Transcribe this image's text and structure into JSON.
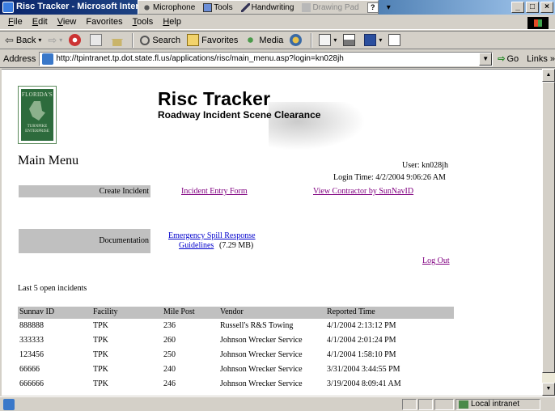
{
  "window": {
    "title": "Risc Tracker - Microsoft Inter",
    "controls": [
      "_",
      "□",
      "×"
    ]
  },
  "language_bar": {
    "microphone": "Microphone",
    "tools": "Tools",
    "handwriting": "Handwriting",
    "drawing_pad": "Drawing Pad",
    "help": "?"
  },
  "menu": {
    "items": [
      {
        "key": "F",
        "rest": "ile"
      },
      {
        "key": "E",
        "rest": "dit"
      },
      {
        "key": "V",
        "rest": "iew"
      },
      {
        "key": "",
        "rest": "Favorites"
      },
      {
        "key": "T",
        "rest": "ools"
      },
      {
        "key": "H",
        "rest": "elp"
      }
    ]
  },
  "toolbar": {
    "back": "Back",
    "search": "Search",
    "favorites": "Favorites",
    "media": "Media"
  },
  "address": {
    "label": "Address",
    "url": "http://tpintranet.tp.dot.state.fl.us/applications/risc/main_menu.asp?login=kn028jh",
    "go": "Go",
    "links": "Links »"
  },
  "page": {
    "logo": {
      "top": "FLORIDA'S",
      "middle": "TURNPIKE",
      "bottom": "ENTERPRISE"
    },
    "app_title": "Risc Tracker",
    "app_subtitle": "Roadway Incident Scene Clearance",
    "main_menu": "Main Menu",
    "user": "User: kn028jh",
    "login_time": "Login Time: 4/2/2004 9:06:26 AM",
    "create_incident_label": "Create Incident",
    "incident_entry_link": "Incident Entry Form",
    "view_contractor_link": "View Contractor by SunNavID",
    "documentation_label": "Documentation",
    "emergency_link_line1": "Emergency Spill Response",
    "emergency_link_line2": "Guidelines",
    "emergency_size": "(7.29 MB)",
    "logout": "Log Out",
    "last5": "Last 5 open incidents"
  },
  "incidents": {
    "columns": [
      "Sunnav ID",
      "Facility",
      "Mile Post",
      "Vendor",
      "Reported Time"
    ],
    "rows": [
      [
        "888888",
        "TPK",
        "236",
        "Russell's R&S Towing",
        "4/1/2004 2:13:12 PM"
      ],
      [
        "333333",
        "TPK",
        "260",
        "Johnson Wrecker Service",
        "4/1/2004 2:01:24 PM"
      ],
      [
        "123456",
        "TPK",
        "250",
        "Johnson Wrecker Service",
        "4/1/2004 1:58:10 PM"
      ],
      [
        "66666",
        "TPK",
        "240",
        "Johnson Wrecker Service",
        "3/31/2004 3:44:55 PM"
      ],
      [
        "666666",
        "TPK",
        "246",
        "Johnson Wrecker Service",
        "3/19/2004 8:09:41 AM"
      ]
    ]
  },
  "status": {
    "zone": "Local intranet"
  }
}
